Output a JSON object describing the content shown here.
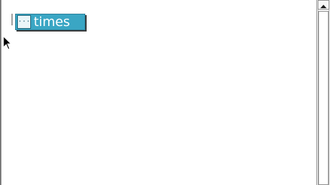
{
  "editor": {
    "token": {
      "label": "times",
      "icon": "block-icon",
      "color": "#3aa6c4"
    }
  },
  "scrollbar": {
    "up_icon": "chevron-up-icon"
  }
}
